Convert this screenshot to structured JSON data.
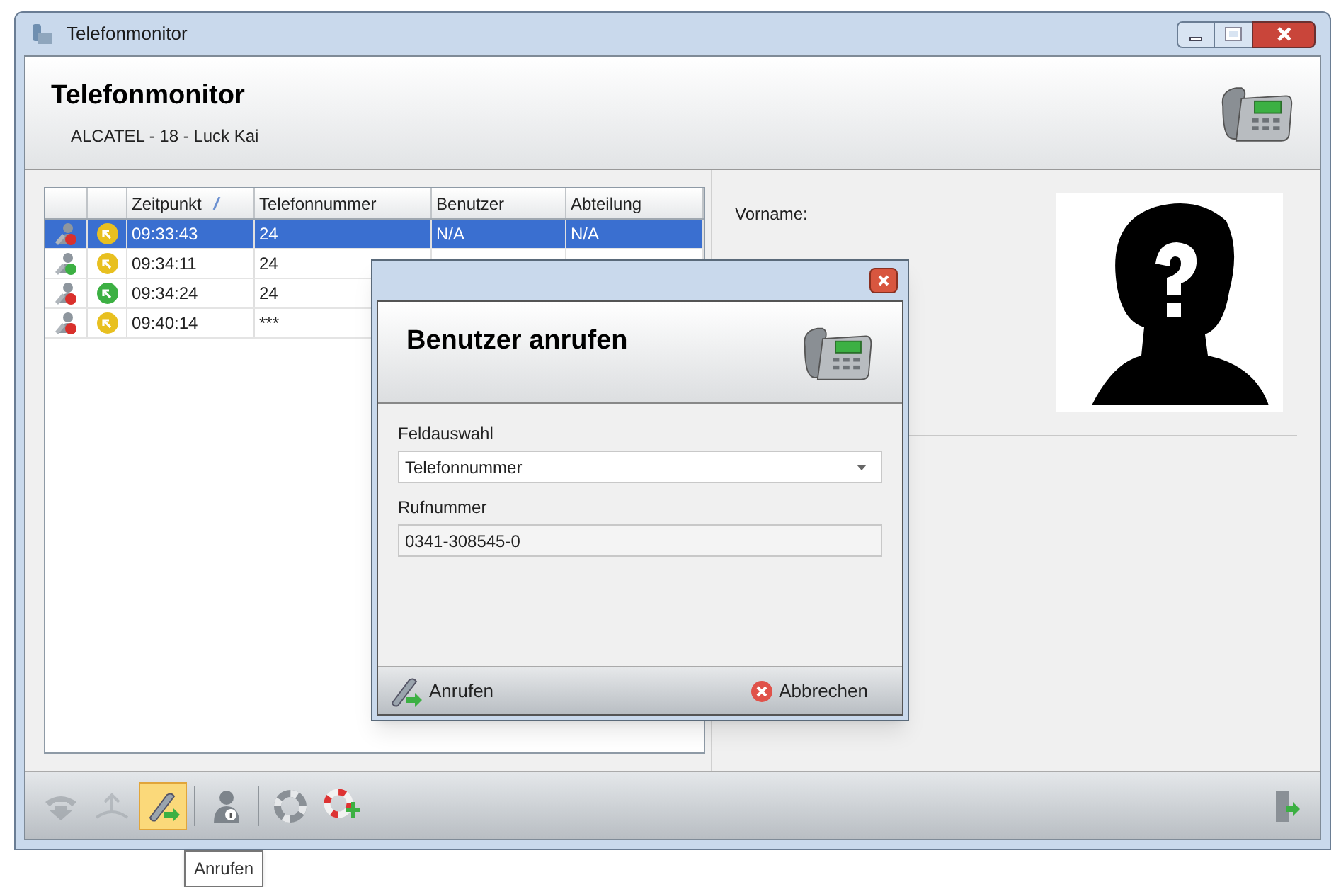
{
  "window": {
    "title": "Telefonmonitor"
  },
  "header": {
    "title": "Telefonmonitor",
    "subtitle": "ALCATEL - 18 - Luck Kai"
  },
  "table": {
    "columns": [
      "",
      "",
      "Zeitpunkt",
      "Telefonnummer",
      "Benutzer",
      "Abteilung"
    ],
    "rows": [
      {
        "selected": true,
        "kind": "failed",
        "color": "#e8c020",
        "cells": [
          "",
          "",
          "09:33:43",
          "24",
          "N/A",
          "N/A"
        ]
      },
      {
        "selected": false,
        "kind": "ok",
        "color": "#e8c020",
        "cells": [
          "",
          "",
          "09:34:11",
          "24"
        ]
      },
      {
        "selected": false,
        "kind": "failed",
        "color": "#3cb043",
        "cells": [
          "",
          "",
          "09:34:24",
          "24"
        ]
      },
      {
        "selected": false,
        "kind": "failed",
        "color": "#e8c020",
        "cells": [
          "",
          "",
          "09:40:14",
          "***"
        ]
      }
    ]
  },
  "details": {
    "labels": [
      "Vorname:"
    ]
  },
  "dialog": {
    "title": "Benutzer anrufen",
    "field_label": "Feldauswahl",
    "field_value": "Telefonnummer",
    "number_label": "Rufnummer",
    "number_value": "0341-308545-0",
    "buttons": [
      {
        "kind": "call",
        "label": "Anrufen"
      },
      {
        "kind": "cancel",
        "label": "Abbrechen"
      }
    ]
  },
  "toolbar": {
    "items": [
      {
        "kind": "hangup",
        "selected": false,
        "disabled": true
      },
      {
        "kind": "pickup",
        "selected": false,
        "disabled": true
      },
      {
        "kind": "call",
        "selected": true,
        "disabled": false
      },
      {
        "kind": "separator"
      },
      {
        "kind": "user-info",
        "selected": false,
        "disabled": false
      },
      {
        "kind": "separator"
      },
      {
        "kind": "ring",
        "selected": false,
        "disabled": false
      },
      {
        "kind": "ring-add",
        "selected": false,
        "disabled": false
      }
    ],
    "tooltip": "Anrufen"
  }
}
